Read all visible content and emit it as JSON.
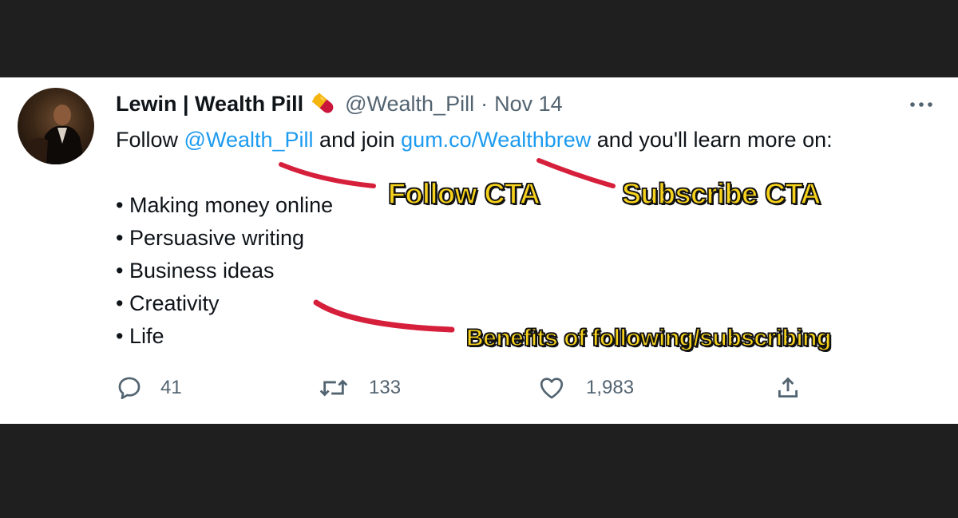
{
  "tweet": {
    "author_name": "Lewin | Wealth Pill",
    "handle": "@Wealth_Pill",
    "separator": "·",
    "date": "Nov 14",
    "text_prefix": "Follow",
    "mention": "@Wealth_Pill",
    "text_middle": "and join",
    "link": "gum.co/Wealthbrew",
    "text_suffix": "and you'll learn more on:",
    "bullets": [
      "• Making money online",
      "• Persuasive writing",
      "• Business ideas",
      "• Creativity",
      "• Life"
    ],
    "actions": {
      "replies": "41",
      "retweets": "133",
      "likes": "1,983"
    }
  },
  "annotations": {
    "follow_cta": "Follow CTA",
    "subscribe_cta": "Subscribe CTA",
    "benefits": "Benefits of following/subscribing"
  },
  "icons": {
    "pill": "pill-emoji-icon",
    "more": "more-options-icon",
    "reply": "reply-icon",
    "retweet": "retweet-icon",
    "like": "heart-icon",
    "share": "share-icon"
  },
  "colors": {
    "link": "#1d9bf0",
    "text": "#0f1419",
    "muted": "#536471",
    "annotation_fill": "#f7d21c",
    "underline": "#d61f3b"
  }
}
